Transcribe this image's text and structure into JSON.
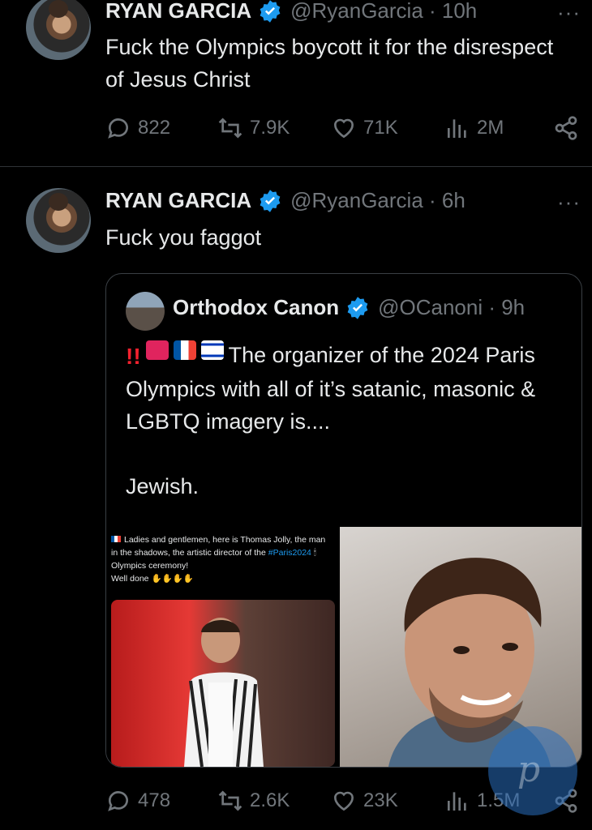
{
  "tweets": [
    {
      "name": "RYAN GARCIA",
      "handle": "@RyanGarcia · 10h",
      "text": "Fuck the Olympics boycott it for the disrespect of Jesus Christ",
      "replies": "822",
      "retweets": "7.9K",
      "likes": "71K",
      "views": "2M",
      "more": "···"
    },
    {
      "name": "RYAN GARCIA",
      "handle": "@RyanGarcia · 6h",
      "text": "Fuck you faggot",
      "replies": "478",
      "retweets": "2.6K",
      "likes": "23K",
      "views": "1.5M",
      "more": "···"
    }
  ],
  "quote": {
    "name": "Orthodox Canon",
    "handle": "@OCanoni · 9h",
    "bangs": "!!",
    "text_line1": "The organizer of the 2024 Paris Olympics with all of it’s satanic, masonic & LGBTQ imagery is....",
    "text_line2": "Jewish.",
    "embedded": {
      "line1": "Ladies and gentlemen, here is Thomas Jolly, the man in the shadows, the artistic director of the",
      "hashtag": "#Paris2024",
      "line2": "Olympics ceremony!",
      "line3": "Well done"
    }
  },
  "icons": {
    "reply": "reply-icon",
    "retweet": "retweet-icon",
    "like": "like-icon",
    "views": "views-icon",
    "share": "share-icon",
    "verified": "verified-icon"
  },
  "colors": {
    "background": "#000000",
    "text": "#e7e9ea",
    "muted": "#71767b",
    "verified": "#1d9bf0"
  }
}
